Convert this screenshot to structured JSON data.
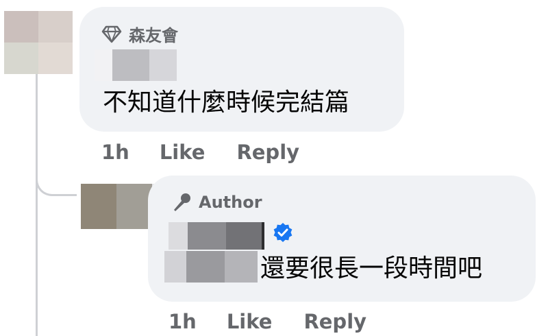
{
  "comment": {
    "badge_label": "森友會",
    "badge_icon": "diamond-icon",
    "text": "不知道什麼時候完結篇",
    "time": "1h",
    "like_label": "Like",
    "reply_label": "Reply"
  },
  "reply": {
    "badge_label": "Author",
    "badge_icon": "microphone-icon",
    "verified_icon": "verified-badge-icon",
    "text": "還要很長一段時間吧",
    "time": "1h",
    "like_label": "Like",
    "reply_label": "Reply"
  },
  "colors": {
    "bubble": "#f0f2f5",
    "secondary_text": "#65676b",
    "thread_line": "#ced0d4",
    "verified": "#1877f2"
  }
}
